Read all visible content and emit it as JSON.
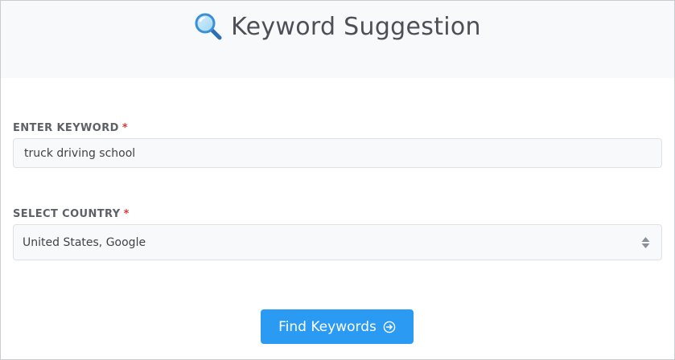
{
  "header": {
    "title": "Keyword Suggestion",
    "icon": "magnifier-icon"
  },
  "form": {
    "keyword": {
      "label": "ENTER KEYWORD",
      "required_mark": "*",
      "value": "truck driving school"
    },
    "country": {
      "label": "SELECT COUNTRY",
      "required_mark": "*",
      "selected": "United States, Google"
    },
    "submit": {
      "label": "Find Keywords",
      "icon": "arrow-circle-right-icon"
    }
  },
  "colors": {
    "accent": "#2b9af3",
    "required": "#d43b3b",
    "header_bg": "#f8f9fb",
    "title_text": "#4b4f56"
  }
}
